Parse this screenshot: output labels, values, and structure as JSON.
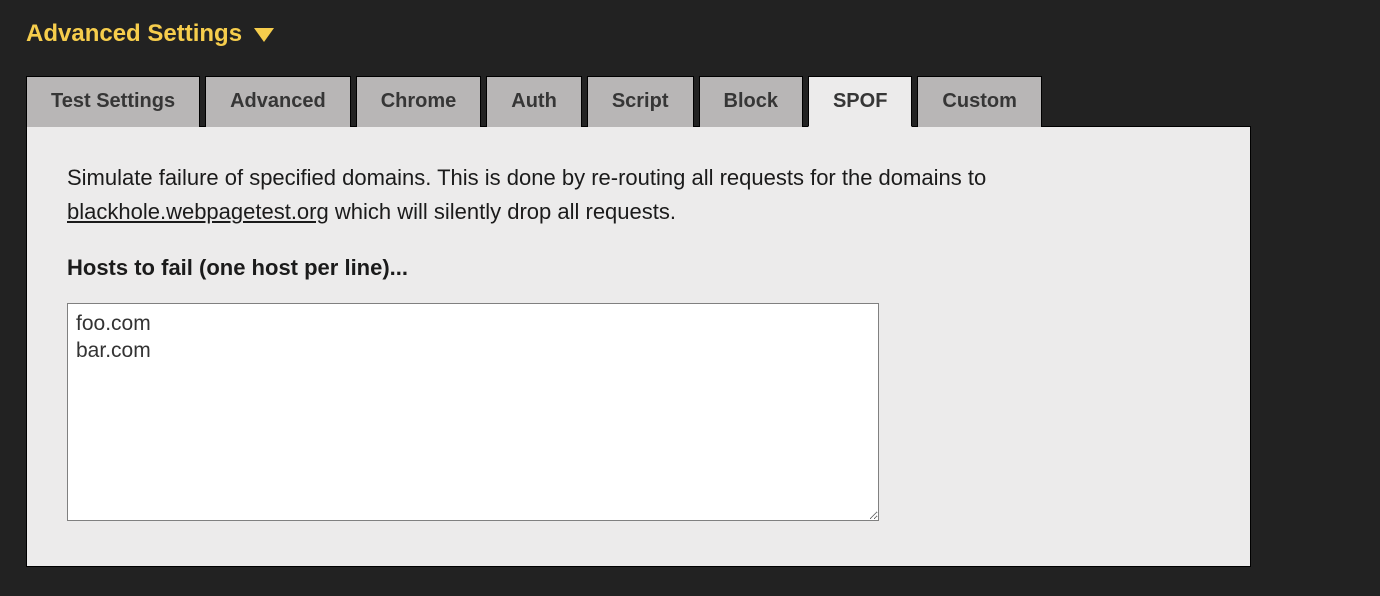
{
  "header": {
    "title": "Advanced Settings"
  },
  "tabs": [
    {
      "label": "Test Settings",
      "active": false
    },
    {
      "label": "Advanced",
      "active": false
    },
    {
      "label": "Chrome",
      "active": false
    },
    {
      "label": "Auth",
      "active": false
    },
    {
      "label": "Script",
      "active": false
    },
    {
      "label": "Block",
      "active": false
    },
    {
      "label": "SPOF",
      "active": true
    },
    {
      "label": "Custom",
      "active": false
    }
  ],
  "panel": {
    "description_prefix": "Simulate failure of specified domains. This is done by re-routing all requests for the domains to ",
    "description_link": "blackhole.webpagetest.org",
    "description_suffix": " which will silently drop all requests.",
    "hosts_label": "Hosts to fail (one host per line)...",
    "hosts_value": "foo.com\nbar.com"
  }
}
